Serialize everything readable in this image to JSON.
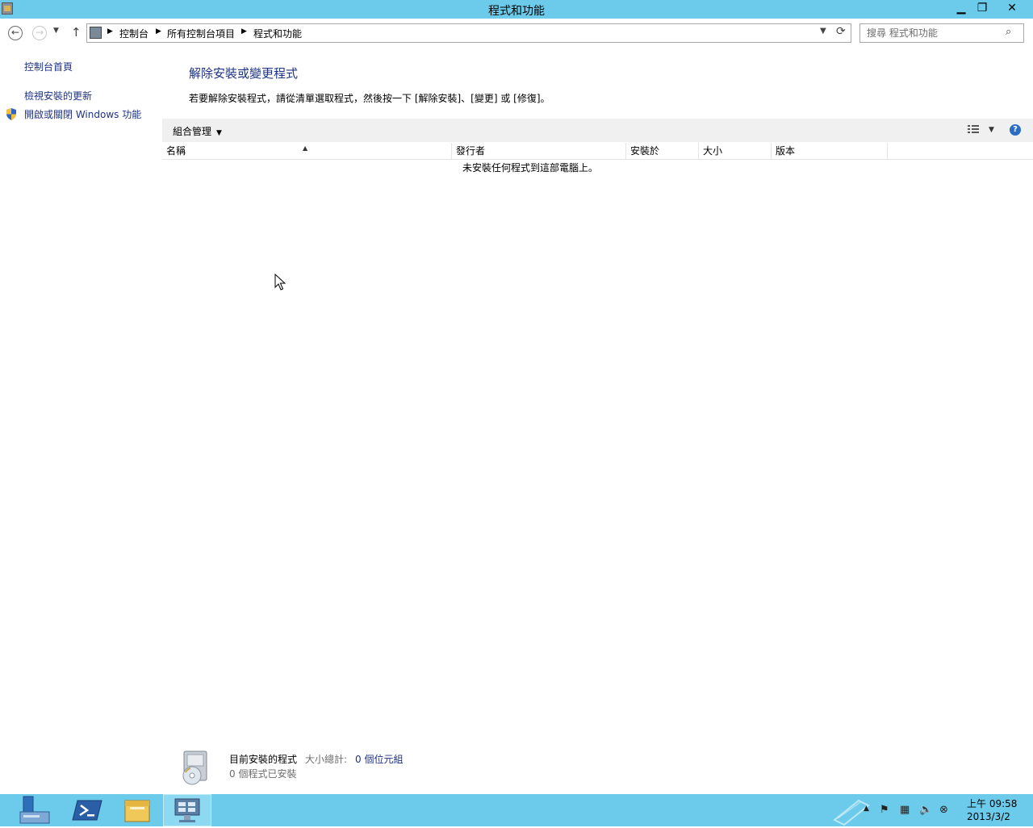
{
  "window": {
    "title": "程式和功能",
    "minimize": "▁",
    "restore": "❐",
    "close": "✕"
  },
  "address": {
    "crumbs": [
      "控制台",
      "所有控制台項目",
      "程式和功能"
    ],
    "search_placeholder": "搜尋 程式和功能"
  },
  "sidebar": {
    "home": "控制台首頁",
    "updates": "檢視安裝的更新",
    "features": "開啟或關閉 Windows 功能"
  },
  "main": {
    "title": "解除安裝或變更程式",
    "description": "若要解除安裝程式，請從清單選取程式，然後按一下 [解除安裝]、[變更] 或 [修復]。",
    "organize": "組合管理",
    "columns": {
      "name": "名稱",
      "publisher": "發行者",
      "installed_on": "安裝於",
      "size": "大小",
      "version": "版本"
    },
    "empty_message": "未安裝任何程式到這部電腦上。"
  },
  "details": {
    "label": "目前安裝的程式",
    "size_label": "大小總計:",
    "size_value": "0 個位元組",
    "count": "0 個程式已安裝"
  },
  "taskbar": {
    "time": "上午 09:58",
    "date": "2013/3/2"
  },
  "colors": {
    "chrome": "#6ccbea",
    "link": "#1e3287",
    "toolbar": "#f0f0f0"
  }
}
